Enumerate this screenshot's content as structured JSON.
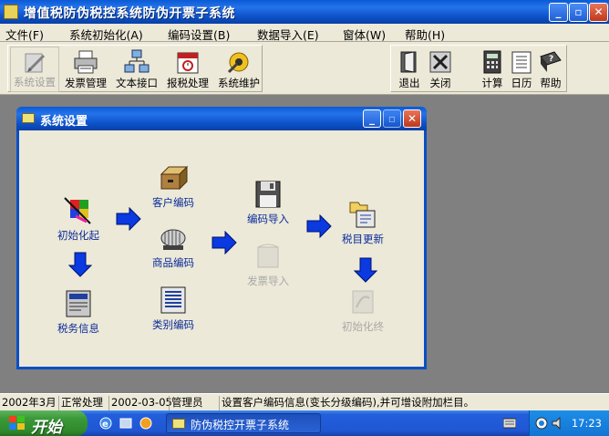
{
  "window": {
    "title": "增值税防伪税控系统防伪开票子系统"
  },
  "menubar": [
    {
      "label": "文件(F)"
    },
    {
      "label": "系统初始化(A)"
    },
    {
      "label": "编码设置(B)"
    },
    {
      "label": "数据导入(E)"
    },
    {
      "label": "窗体(W)"
    },
    {
      "label": "帮助(H)"
    }
  ],
  "toolbar": {
    "left": [
      {
        "label": "系统设置",
        "icon": "settings-pencil-icon",
        "state": "disabled"
      },
      {
        "label": "发票管理",
        "icon": "printer-icon"
      },
      {
        "label": "文本接口",
        "icon": "network-icon"
      },
      {
        "label": "报税处理",
        "icon": "tax-calendar-icon"
      },
      {
        "label": "系统维护",
        "icon": "maintenance-icon"
      }
    ],
    "right": [
      {
        "label": "退出",
        "icon": "exit-door-icon"
      },
      {
        "label": "关闭",
        "icon": "close-x-icon"
      },
      {
        "label": "计算",
        "icon": "calculator-icon"
      },
      {
        "label": "日历",
        "icon": "calendar-icon"
      },
      {
        "label": "帮助",
        "icon": "help-book-icon"
      }
    ]
  },
  "child_window": {
    "title": "系统设置",
    "nodes": {
      "init": {
        "label": "初始化起"
      },
      "tax_info": {
        "label": "税务信息"
      },
      "customer_code": {
        "label": "客户编码"
      },
      "product_code": {
        "label": "商品编码"
      },
      "category_code": {
        "label": "类别编码"
      },
      "code_import": {
        "label": "编码导入"
      },
      "invoice_import": {
        "label": "发票导入",
        "state": "disabled"
      },
      "tax_update": {
        "label": "税目更新"
      },
      "init_end": {
        "label": "初始化终",
        "state": "disabled"
      }
    }
  },
  "statusbar": {
    "period": "2002年3月",
    "mode": "正常处理",
    "date": "2002-03-05",
    "user": "管理员",
    "message": "设置客户编码信息(变长分级编码),并可增设附加栏目。"
  },
  "taskbar": {
    "start_label": "开始",
    "task_label": "防伪税控开票子系统",
    "clock": "17:23"
  },
  "colors": {
    "titlebar": "#0a5ad6",
    "flow_text": "#0a2a9a",
    "arrow": "#0a3ae0",
    "start": "#3c9a3a"
  }
}
